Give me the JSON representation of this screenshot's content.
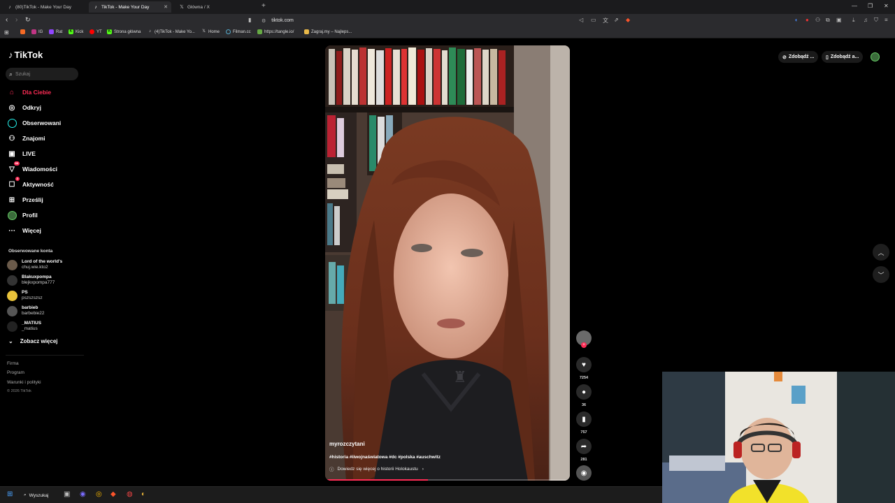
{
  "browser": {
    "tabs": [
      {
        "label": "(80)TikTok - Make Your Day",
        "active": false
      },
      {
        "label": "TikTok - Make Your Day",
        "active": true
      },
      {
        "label": "Główna / X",
        "active": false
      }
    ],
    "url": "tiktok.com",
    "bookmarks": [
      "IG",
      "Rat",
      "Kick",
      "YT",
      "Strona główna",
      "(4)TikTok - Make Yo...",
      "Home",
      "Filman.cc",
      "https://tangle.io/",
      "Zagraj.my – Najleps..."
    ]
  },
  "sidebar": {
    "logo": "TikTok",
    "search_placeholder": "Szukaj",
    "nav": [
      {
        "label": "Dla Ciebie",
        "icon": "home-icon",
        "active": true
      },
      {
        "label": "Odkryj",
        "icon": "compass-icon"
      },
      {
        "label": "Obserwowani",
        "icon": "following-icon"
      },
      {
        "label": "Znajomi",
        "icon": "friends-icon"
      },
      {
        "label": "LIVE",
        "icon": "live-icon"
      },
      {
        "label": "Wiadomości",
        "icon": "messages-icon",
        "badge": "99"
      },
      {
        "label": "Aktywność",
        "icon": "activity-icon",
        "badge": "2"
      },
      {
        "label": "Prześlij",
        "icon": "upload-icon"
      },
      {
        "label": "Profil",
        "icon": "profile-icon"
      },
      {
        "label": "Więcej",
        "icon": "more-icon"
      }
    ],
    "followed_heading": "Obserwowane konta",
    "followed": [
      {
        "name": "Lord of the world's",
        "user": "chuj.wie.kto2"
      },
      {
        "name": "Blakuxpompa",
        "user": "blejkxpompa777"
      },
      {
        "name": "PS",
        "user": "pszszszsz"
      },
      {
        "name": "barbieb",
        "user": "barbebie22"
      },
      {
        "name": "_MATIUS",
        "user": "_matius"
      }
    ],
    "see_more": "Zobacz więcej",
    "footer": [
      "Firma",
      "Program",
      "Warunki i polityki"
    ],
    "copyright": "© 2026 TikTok"
  },
  "video": {
    "username": "myrozczytani",
    "hashtags": "#historia #iiwojnaświatowa #dc #polska #auschwitz",
    "info_link": "Dowiedz się więcej o historii Holokaustu",
    "progress": 0.42,
    "likes": "7254",
    "comments": "36",
    "saves": "757",
    "shares": "281"
  },
  "topright": {
    "btn1": "Zdobądź ...",
    "btn2": "Zdobądź a..."
  },
  "taskbar": {
    "search_label": "Wyszukaj"
  },
  "colors": {
    "accent": "#fe2c55",
    "background": "#000000"
  }
}
